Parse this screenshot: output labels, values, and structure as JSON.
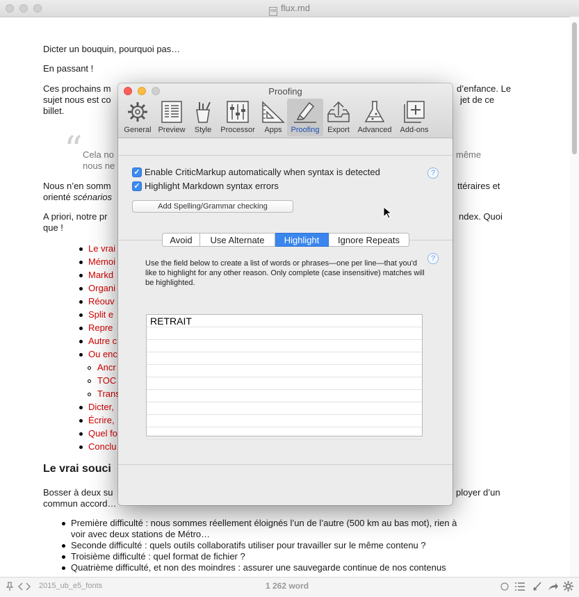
{
  "window": {
    "filename": "flux.md"
  },
  "document": {
    "p1": "Dicter un bouquin, pourquoi pas…",
    "p2": "En passant !",
    "p3_line1_left": "Ces prochains m",
    "p3_line1_right": "d’enfance. Le",
    "p3_line2_left": "sujet nous est co",
    "p3_line2_right": "jet de ce",
    "p3_line3": "billet.",
    "quote_line1_left": "Cela no",
    "quote_line1_right": "même",
    "quote_line2_left": "nous ne",
    "p4_line1_left": "Nous n’en somm",
    "p4_line1_right": "ttéraires et",
    "p4_line2_left": "orienté",
    "p4_line2_italic": "scénarios",
    "p5_line1_left": "A priori, notre pr",
    "p5_line1_right": "ndex. Quoi",
    "p5_line2": "que !",
    "list_items": [
      "Le vrai",
      "Mémoi",
      "Markd",
      "Organi",
      "Réouv",
      "Split e",
      "Repre",
      "Autre c",
      "Ou enc"
    ],
    "sub_items": [
      "Ancr",
      "TOC",
      "Trans"
    ],
    "list_items2": [
      "Dicter,",
      "Écrire,",
      "Quel fo",
      "Conclu"
    ],
    "heading": "Le vrai souci",
    "p6_line1_left": "Bosser à deux su",
    "p6_line1_right": "ployer d’un",
    "p6_line2": "commun accord…",
    "bullets": [
      "Première difficulté : nous sommes réellement éloignés l’un de l’autre (500 km au bas mot), rien à",
      "voir avec deux stations de Métro…",
      "Seconde difficulté : quels outils collaboratifs utiliser pour travailler sur le même contenu ?",
      "Troisième difficulté : quel format de fichier ?",
      "Quatrième difficulté, et non des moindres : assurer une sauvegarde continue de nos contenus"
    ]
  },
  "statusbar": {
    "filename": "2015_ub_e5_fonts",
    "word_count": "1 262 word"
  },
  "dialog": {
    "title": "Proofing",
    "toolbar": [
      "General",
      "Preview",
      "Style",
      "Processor",
      "Apps",
      "Proofing",
      "Export",
      "Advanced",
      "Add-ons"
    ],
    "selected_tab": "Proofing",
    "checkbox1": "Enable CriticMarkup automatically when syntax is detected",
    "checkbox2": "Highlight Markdown syntax errors",
    "spelling_button": "Add Spelling/Grammar checking",
    "help": "?",
    "segments": [
      "Avoid",
      "Use Alternate",
      "Highlight",
      "Ignore Repeats"
    ],
    "selected_segment": "Highlight",
    "description": "Use the field below to create a list of words or phrases—one per line—that you'd like to highlight for any other reason. Only complete (case insensitive) matches will be highlighted.",
    "words": [
      "RETRAIT",
      "",
      "",
      "",
      "",
      "",
      "",
      "",
      "",
      ""
    ]
  },
  "colors": {
    "accent": "#3a86ee",
    "link_red": "#d40000"
  }
}
